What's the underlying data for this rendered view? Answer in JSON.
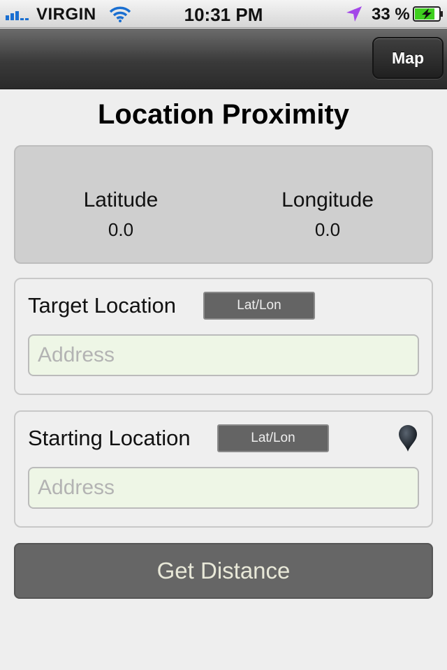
{
  "status_bar": {
    "carrier": "VIRGIN",
    "time": "10:31 PM",
    "battery_percent": "33 %",
    "icons": [
      "signal-bars-icon",
      "wifi-icon",
      "location-arrow-icon",
      "battery-charging-icon"
    ],
    "battery_level": 0.33
  },
  "nav": {
    "map_button": "Map"
  },
  "title": "Location Proximity",
  "coordinates": {
    "latitude_label": "Latitude",
    "latitude_value": "0.0",
    "longitude_label": "Longitude",
    "longitude_value": "0.0"
  },
  "target": {
    "label": "Target Location",
    "mode_button": "Lat/Lon",
    "address_placeholder": "Address",
    "address_value": ""
  },
  "start": {
    "label": "Starting Location",
    "mode_button": "Lat/Lon",
    "address_placeholder": "Address",
    "address_value": "",
    "icon": "map-pin-icon"
  },
  "action": {
    "get_distance": "Get Distance"
  },
  "colors": {
    "nav_bar": "#3a3a3a",
    "panel": "#cfcfcf",
    "input_fill": "#eef6e6",
    "button": "#666666",
    "battery_green": "#3fcf1f",
    "location_arrow": "#a347e8"
  }
}
